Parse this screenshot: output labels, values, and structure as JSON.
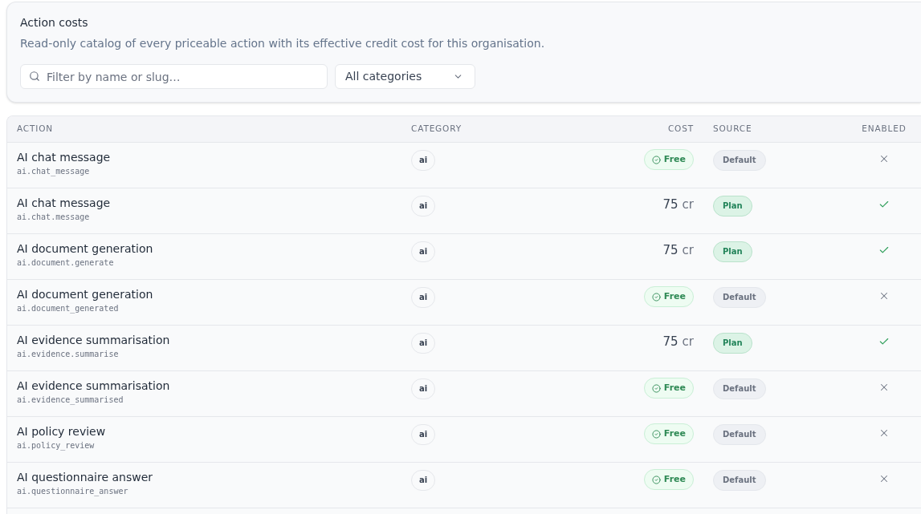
{
  "header": {
    "title": "Action costs",
    "description": "Read-only catalog of every priceable action with its effective credit cost for this organisation.",
    "search": {
      "placeholder": "Filter by name or slug…"
    },
    "category_select": {
      "value": "All categories"
    }
  },
  "table": {
    "columns": [
      "ACTION",
      "CATEGORY",
      "COST",
      "SOURCE",
      "ENABLED"
    ],
    "rows": [
      {
        "name": "AI chat message",
        "slug": "ai.chat_message",
        "category": "ai",
        "cost": {
          "kind": "free",
          "label": "Free"
        },
        "source": {
          "kind": "default",
          "label": "Default"
        },
        "enabled": false
      },
      {
        "name": "AI chat message",
        "slug": "ai.chat.message",
        "category": "ai",
        "cost": {
          "kind": "credits",
          "amount": "75",
          "unit": "cr"
        },
        "source": {
          "kind": "plan",
          "label": "Plan"
        },
        "enabled": true
      },
      {
        "name": "AI document generation",
        "slug": "ai.document.generate",
        "category": "ai",
        "cost": {
          "kind": "credits",
          "amount": "75",
          "unit": "cr"
        },
        "source": {
          "kind": "plan",
          "label": "Plan"
        },
        "enabled": true
      },
      {
        "name": "AI document generation",
        "slug": "ai.document_generated",
        "category": "ai",
        "cost": {
          "kind": "free",
          "label": "Free"
        },
        "source": {
          "kind": "default",
          "label": "Default"
        },
        "enabled": false
      },
      {
        "name": "AI evidence summarisation",
        "slug": "ai.evidence.summarise",
        "category": "ai",
        "cost": {
          "kind": "credits",
          "amount": "75",
          "unit": "cr"
        },
        "source": {
          "kind": "plan",
          "label": "Plan"
        },
        "enabled": true
      },
      {
        "name": "AI evidence summarisation",
        "slug": "ai.evidence_summarised",
        "category": "ai",
        "cost": {
          "kind": "free",
          "label": "Free"
        },
        "source": {
          "kind": "default",
          "label": "Default"
        },
        "enabled": false
      },
      {
        "name": "AI policy review",
        "slug": "ai.policy_review",
        "category": "ai",
        "cost": {
          "kind": "free",
          "label": "Free"
        },
        "source": {
          "kind": "default",
          "label": "Default"
        },
        "enabled": false
      },
      {
        "name": "AI questionnaire answer",
        "slug": "ai.questionnaire_answer",
        "category": "ai",
        "cost": {
          "kind": "free",
          "label": "Free"
        },
        "source": {
          "kind": "default",
          "label": "Default"
        },
        "enabled": false
      }
    ]
  }
}
